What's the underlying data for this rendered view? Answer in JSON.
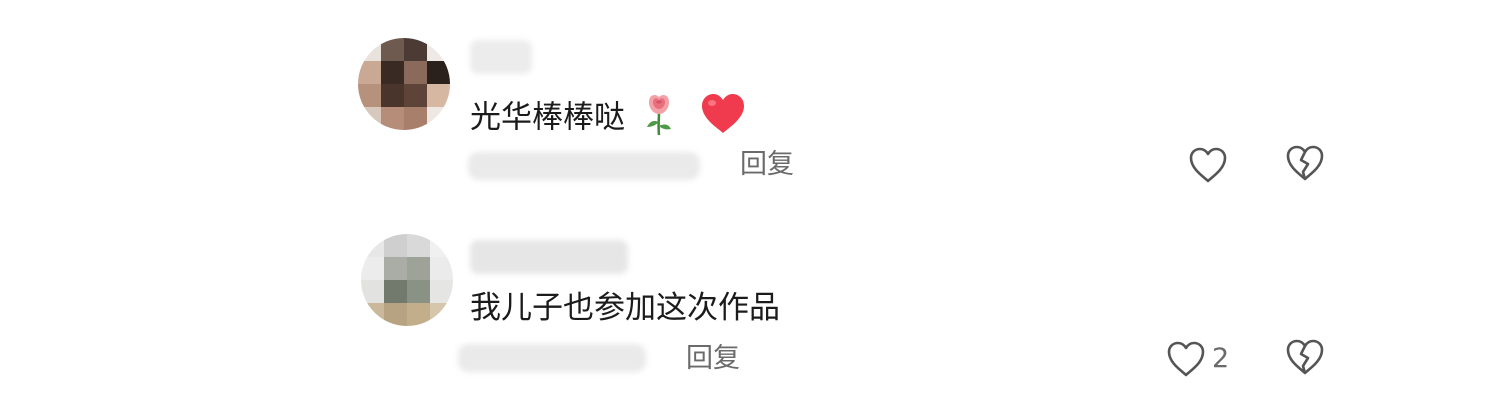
{
  "comments": [
    {
      "text": "光华棒棒哒",
      "emojis": [
        "rose",
        "red-heart"
      ],
      "reply_label": "回复",
      "like_count": "",
      "like_icon": "heart-outline-icon",
      "dislike_icon": "broken-heart-outline-icon"
    },
    {
      "text": "我儿子也参加这次作品",
      "emojis": [],
      "reply_label": "回复",
      "like_count": "2",
      "like_icon": "heart-outline-icon",
      "dislike_icon": "broken-heart-outline-icon"
    }
  ],
  "colors": {
    "text": "#1b1b1b",
    "secondary_text": "#6b6b6b",
    "icon_stroke": "#555555",
    "heart_red": "#ef3b4d"
  }
}
